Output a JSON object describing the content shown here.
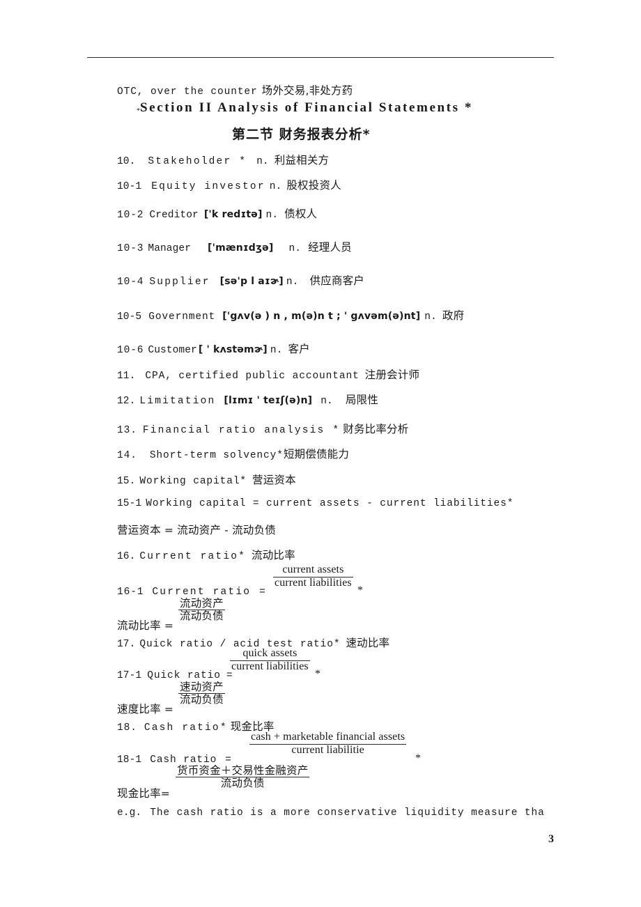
{
  "document": {
    "page_number": "3",
    "header_rule": true
  },
  "lines": {
    "otc": {
      "english": "OTC, over the counter",
      "chinese": "场外交易,非处方药"
    },
    "section_heading": {
      "leading_mark": "*",
      "english": "Section II Analysis of Financial Statements *",
      "chinese": "第二节 财务报表分析*"
    },
    "item10": {
      "number": "10.",
      "english": "Stakeholder *",
      "pos": "n.",
      "chinese": "利益相关方"
    },
    "item10_1": {
      "number": "10-1",
      "english": "Equity investor",
      "pos": "n.",
      "chinese": "股权投资人"
    },
    "item10_2": {
      "number": "10-2",
      "english": "Creditor",
      "ipa": "['k redɪtə]",
      "pos": "n.",
      "chinese": "债权人"
    },
    "item10_3": {
      "number": "10-3",
      "english": "Manager",
      "ipa": "['mænɪdʒə]",
      "pos": "n.",
      "chinese": "经理人员"
    },
    "item10_4": {
      "number": "10-4",
      "english": "Supplier",
      "ipa": "[sə'p l aɪɚ]",
      "pos": "n.",
      "chinese": "供应商客户"
    },
    "item10_5": {
      "number": "10-5",
      "english": "Government",
      "ipa": "['gʌv(ə ) n , m(ə)n t ;  ' gʌvəm(ə)nt]",
      "pos": "n.",
      "chinese": "政府"
    },
    "item10_6": {
      "number": "10-6",
      "english": "Customer",
      "ipa": "[ ' kʌstəmɚ]",
      "pos": "n.",
      "chinese": "客户"
    },
    "item11": {
      "number": "11.",
      "english": "CPA,  certified public accountant",
      "chinese": "注册会计师"
    },
    "item12": {
      "number": "12.",
      "english": "Limitation",
      "ipa": "[lɪmɪ ' teɪʃ(ə)n]",
      "pos": "n.",
      "chinese": "局限性"
    },
    "item13": {
      "number": "13.",
      "english": "Financial ratio analysis *",
      "chinese": "财务比率分析"
    },
    "item14": {
      "number": "14.",
      "english": "Short-term solvency*",
      "chinese": "短期偿债能力"
    },
    "item15": {
      "number": "15.",
      "english": "Working capital*",
      "chinese": "营运资本"
    },
    "item15_1": {
      "number": "15-1",
      "english": "Working capital  =  current  assets  -  current liabilities*",
      "chinese": "营运资本 = 流动资产  -  流动负债"
    },
    "item16": {
      "number": "16.",
      "english": "Current  ratio*",
      "chinese": "流动比率"
    },
    "item16_1": {
      "number": "16-1",
      "english": "Current ratio",
      "equals": "=",
      "numerator": "current assets",
      "denominator": "current liabilities",
      "star": "*",
      "chinese_label": "流动比率 =",
      "chinese_numerator": "流动资产",
      "chinese_denominator": "流动负债"
    },
    "item17": {
      "number": "17.",
      "english": "Quick ratio / acid test ratio*",
      "chinese": "速动比率"
    },
    "item17_1": {
      "number": "17-1",
      "english": "Quick  ratio",
      "equals": "=",
      "numerator": "quick assets",
      "denominator": "current liabilities",
      "star": "*",
      "chinese_label": "速度比率 =",
      "chinese_numerator": "速动资产",
      "chinese_denominator": "流动负债"
    },
    "item18": {
      "number": "18.",
      "english": "Cash  ratio*",
      "chinese": "现金比率"
    },
    "item18_1": {
      "number": "18-1",
      "english": "Cash ratio",
      "equals": "=",
      "numerator": "cash + marketable financial assets",
      "denominator": "current liabilitie",
      "star": "*",
      "chinese_label": "现金比率=",
      "chinese_numerator": "货币资金＋交易性金融资产",
      "chinese_denominator": "流动负债"
    },
    "example": {
      "label": "e.g.",
      "text": "The cash  ratio is a more conservative  liquidity measure tha"
    }
  }
}
